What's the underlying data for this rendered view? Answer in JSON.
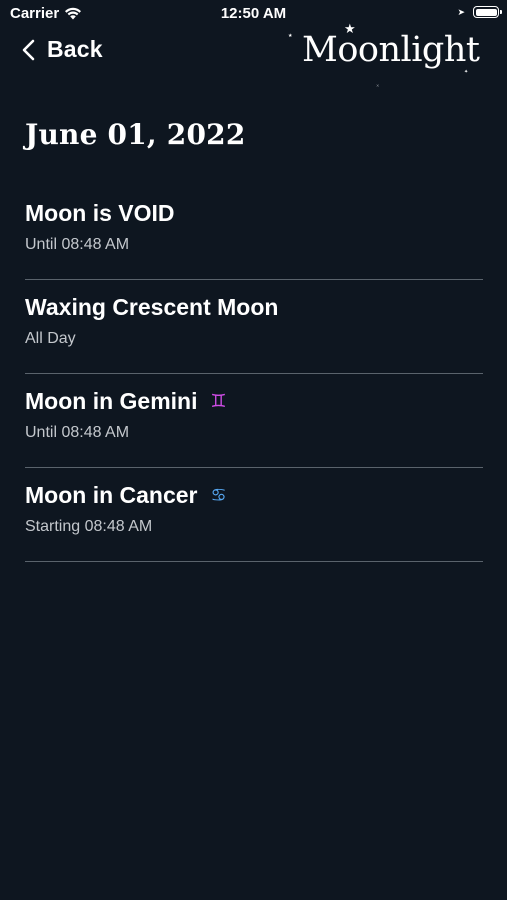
{
  "status_bar": {
    "carrier": "Carrier",
    "time": "12:50 AM"
  },
  "nav": {
    "back_label": "Back",
    "brand": "Moonlight"
  },
  "page": {
    "date_title": "June 01, 2022"
  },
  "events": [
    {
      "title": "Moon is VOID",
      "subtitle": "Until 08:48 AM",
      "icon": ""
    },
    {
      "title": "Waxing Crescent Moon",
      "subtitle": "All Day",
      "icon": ""
    },
    {
      "title": "Moon in Gemini",
      "subtitle": "Until 08:48 AM",
      "icon": "gemini-icon",
      "icon_glyph": "♊",
      "icon_color": "#d14de8"
    },
    {
      "title": "Moon in Cancer",
      "subtitle": "Starting 08:48 AM",
      "icon": "cancer-icon",
      "icon_glyph": "♋",
      "icon_color": "#57a8f2"
    }
  ],
  "colors": {
    "background": "#0e1620",
    "divider": "#5a636c",
    "subtitle": "#c3c7cc"
  }
}
